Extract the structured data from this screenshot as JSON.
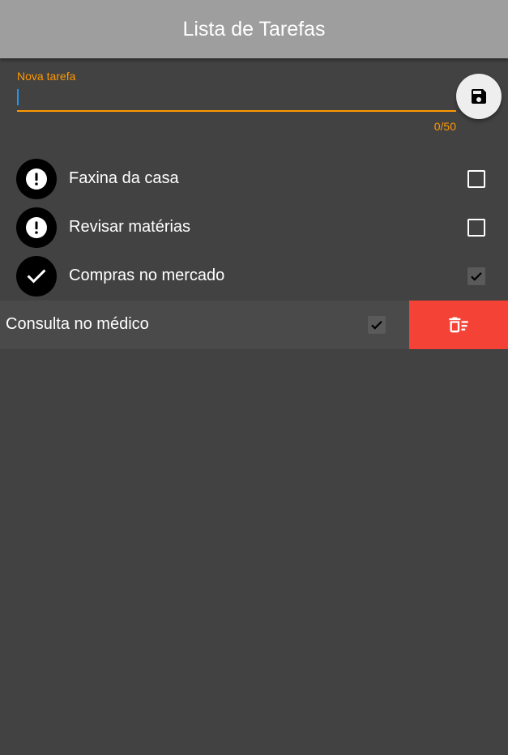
{
  "app_bar": {
    "title": "Lista de Tarefas"
  },
  "new_task": {
    "label": "Nova tarefa",
    "value": "",
    "counter": "0/50",
    "save_icon": "floppy-disk-icon"
  },
  "tasks": [
    {
      "title": "Faxina da casa",
      "done": false,
      "status_icon": "exclamation-icon"
    },
    {
      "title": "Revisar matérias",
      "done": false,
      "status_icon": "exclamation-icon"
    },
    {
      "title": "Compras no mercado",
      "done": true,
      "status_icon": "check-icon"
    },
    {
      "title": "Consulta no médico",
      "done": true,
      "status_icon": "check-icon",
      "swiping": true
    }
  ],
  "dismiss_action": {
    "icon": "delete-sweep-icon"
  },
  "colors": {
    "app_bar": "#9e9e9e",
    "background": "#424242",
    "accent": "#ff9800",
    "delete": "#f44336",
    "cursor": "#2196f3"
  }
}
